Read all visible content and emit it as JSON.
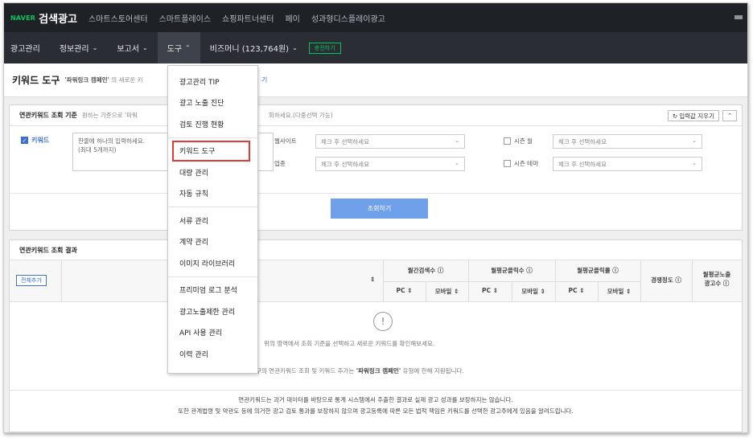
{
  "topbar": {
    "logo_naver": "NAVER",
    "logo_title": "검색광고",
    "links": [
      "스마트스토어센터",
      "스마트플레이스",
      "쇼핑파트너센터",
      "페이",
      "성과형디스플레이광고"
    ]
  },
  "nav": {
    "items": [
      {
        "label": "광고관리",
        "caret": false
      },
      {
        "label": "정보관리",
        "caret": true
      },
      {
        "label": "보고서",
        "caret": true
      },
      {
        "label": "도구",
        "caret": true,
        "active": true
      },
      {
        "label": "비즈머니 (123,764원)",
        "caret": true
      }
    ],
    "charge_label": "충전하기"
  },
  "page": {
    "title": "키워드 도구",
    "desc_bold": "'파워링크 캠페인'",
    "desc": "의 새로운 키",
    "link_fragment": "기"
  },
  "criteria": {
    "header_title": "연관키워드 조회 기준",
    "header_desc": "원하는 기준으로 '파워",
    "header_desc2": "회하세요.(다중선택 가능)",
    "reset_label": "입력값 지우기",
    "keyword_label": "키워드",
    "keyword_placeholder_1": "한줄에 하나의 입력하세요.",
    "keyword_placeholder_2": "(최대 5개까지)",
    "website_label": "웹사이트",
    "industry_label": "업종",
    "season_month_label": "시즌 월",
    "season_theme_label": "시즌 테마",
    "select_placeholder": "체크 후 선택하세요",
    "search_label": "조회하기"
  },
  "results": {
    "title": "연관키워드 조회 결과",
    "add_all_label": "전체추가",
    "columns": {
      "monthly_search": "월간검색수",
      "avg_clicks": "월평균클릭수",
      "avg_ctr": "월평균클릭률",
      "competition": "경쟁정도",
      "avg_ad_count_1": "월평균노출",
      "avg_ad_count_2": "광고수",
      "pc": "PC",
      "mobile": "모바일"
    },
    "empty_icon": "!",
    "empty_msg_1": "위의 영역에서 조회 기준을 선택하고 새로운 키워드를 확인해보세요.",
    "empty_msg_2_prefix": "키워드 도구의 연관키워드 조회 및 키워드 추가는",
    "empty_msg_2_bold": "'파워링크 캠페인'",
    "empty_msg_2_suffix": "유형에 한해 지원됩니다."
  },
  "footnote": {
    "line1": "연관키워드는 과거 데이터를 바탕으로 통계 시스템에서 추출한 결과로 실제 광고 성과를 보장하지는 않습니다.",
    "line2": "또한 관계법령 및 약관도 등에 의거한 광고 검토 통과를 보장하지 않으며 광고등록에 따른 모든 법적 책임은 키워드를 선택한 광고주에게 있음을 알려드립니다."
  },
  "dropdown": {
    "group1": [
      "광고관리 TIP",
      "광고 노출 진단",
      "검토 진행 현황"
    ],
    "group2": [
      "키워드 도구",
      "대량 관리",
      "자동 규칙"
    ],
    "group3": [
      "서류 관리",
      "계약 관리",
      "이미지 라이브러리"
    ],
    "group4": [
      "프리미엄 로그 분석",
      "광고노출제한 관리",
      "API 사용 관리",
      "이력 관리"
    ]
  },
  "colors": {
    "naver_green": "#03c75a",
    "accent_blue": "#3b6fd8",
    "highlight_red": "#e53935"
  }
}
